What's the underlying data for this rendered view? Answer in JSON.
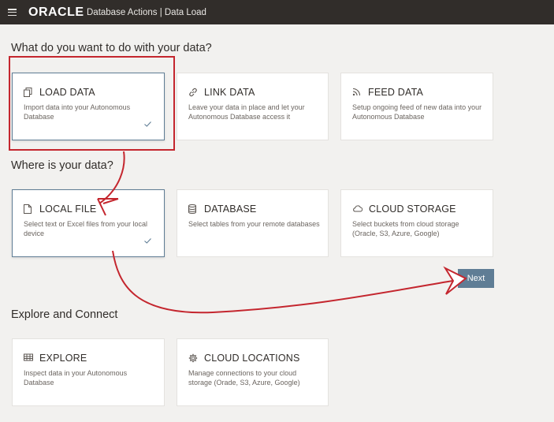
{
  "header": {
    "logo": "ORACLE",
    "app_title": "Database Actions  |  Data Load"
  },
  "sections": {
    "what": "What do you want to do with your data?",
    "where": "Where is your data?",
    "explore": "Explore and Connect"
  },
  "what_cards": [
    {
      "title": "LOAD DATA",
      "icon": "copy-icon",
      "desc": "Import data into your Autonomous Database",
      "selected": true
    },
    {
      "title": "LINK DATA",
      "icon": "link-icon",
      "desc": "Leave your data in place and let your Autonomous Database access it",
      "selected": false
    },
    {
      "title": "FEED DATA",
      "icon": "feed-icon",
      "desc": "Setup ongoing feed of new data into your Autonomous Database",
      "selected": false
    }
  ],
  "where_cards": [
    {
      "title": "LOCAL FILE",
      "icon": "file-icon",
      "desc": "Select text or Excel files from your local device",
      "selected": true
    },
    {
      "title": "DATABASE",
      "icon": "database-icon",
      "desc": "Select tables from your remote databases",
      "selected": false
    },
    {
      "title": "CLOUD STORAGE",
      "icon": "cloud-icon",
      "desc": "Select buckets from cloud storage (Oracle, S3, Azure, Google)",
      "selected": false
    }
  ],
  "explore_cards": [
    {
      "title": "EXPLORE",
      "icon": "table-icon",
      "desc": "Inspect data in your Autonomous Database"
    },
    {
      "title": "CLOUD LOCATIONS",
      "icon": "gear-icon",
      "desc": "Manage connections to your cloud storage (Orade, S3, Azure, Google)"
    }
  ],
  "next_label": "Next",
  "colors": {
    "topbar": "#312d2a",
    "accent": "#5f7d95",
    "annotation": "#c4262e",
    "background": "#f2f1ef"
  }
}
